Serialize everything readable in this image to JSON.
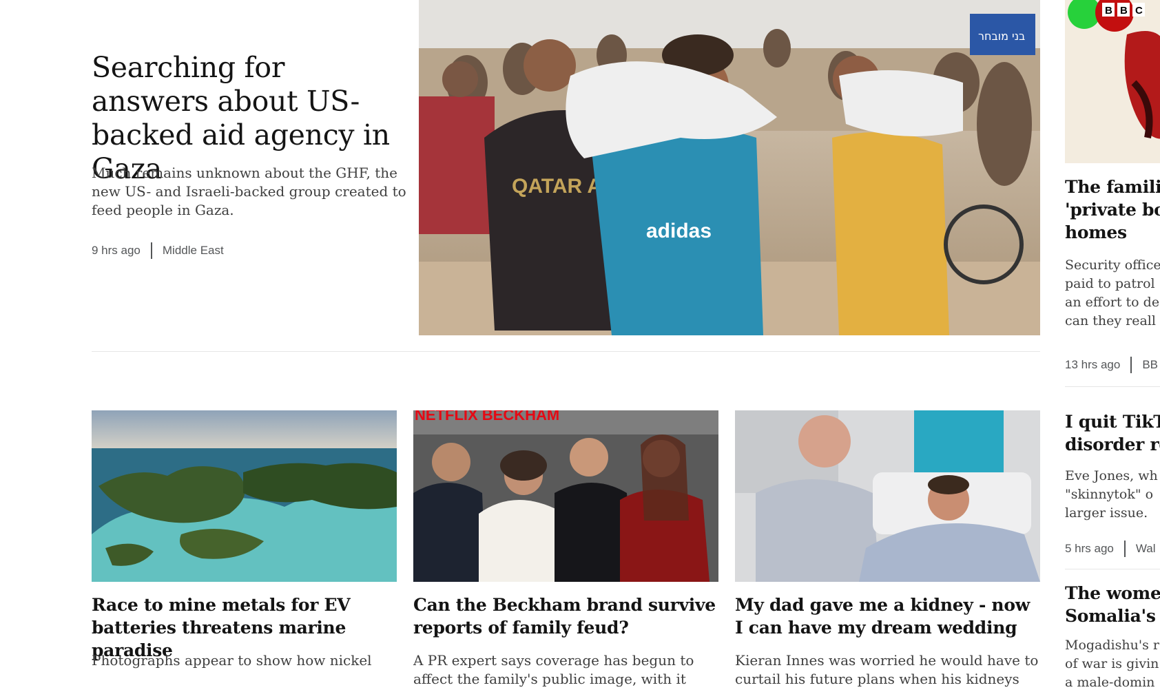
{
  "hero": {
    "title": "Searching for answers about US-backed aid agency in Gaza",
    "summary": "Much remains unknown about the GHF, the new US- and Israeli-backed group created to feed people in Gaza.",
    "time": "9 hrs ago",
    "section": "Middle East",
    "image_text": {
      "shirt1": "QATAR AIRWAYS",
      "shirt2": "adidas",
      "sign": "בני מובחר"
    }
  },
  "right_column": {
    "image_logo": "BBC",
    "items": [
      {
        "title_lines": [
          "The familie",
          "'private bol",
          "homes"
        ],
        "summary_lines": [
          "Security office",
          "paid to patrol",
          "an effort to de",
          "can they reall"
        ],
        "time": "13 hrs ago",
        "section": "BB"
      },
      {
        "title_lines": [
          "I quit TikT",
          "disorder re"
        ],
        "summary_lines": [
          "Eve Jones, wh",
          "\"skinnytok\" o",
          "larger issue."
        ],
        "time": "5 hrs ago",
        "section": "Wal"
      },
      {
        "title_lines": [
          "The women",
          "Somalia's c"
        ],
        "summary_lines": [
          "Mogadishu's r",
          "of war is givin",
          "a male-domin"
        ]
      }
    ]
  },
  "cards": [
    {
      "title": "Race to mine metals for EV batteries threatens marine paradise",
      "summary": "Photographs appear to show how nickel"
    },
    {
      "title": "Can the Beckham brand survive reports of family feud?",
      "summary": "A PR expert says coverage has begun to affect the family's public image, with it",
      "image_text": "NETFLIX BECKHAM"
    },
    {
      "title": "My dad gave me a kidney - now I can have my dream wedding",
      "summary": "Kieran Innes was worried he would have to curtail his future plans when his kidneys"
    }
  ],
  "colors": {
    "text": "#141414",
    "summary": "#3f3f3f",
    "meta": "#545658",
    "divider": "#e6e6e6",
    "bbc_red": "#b80000"
  }
}
